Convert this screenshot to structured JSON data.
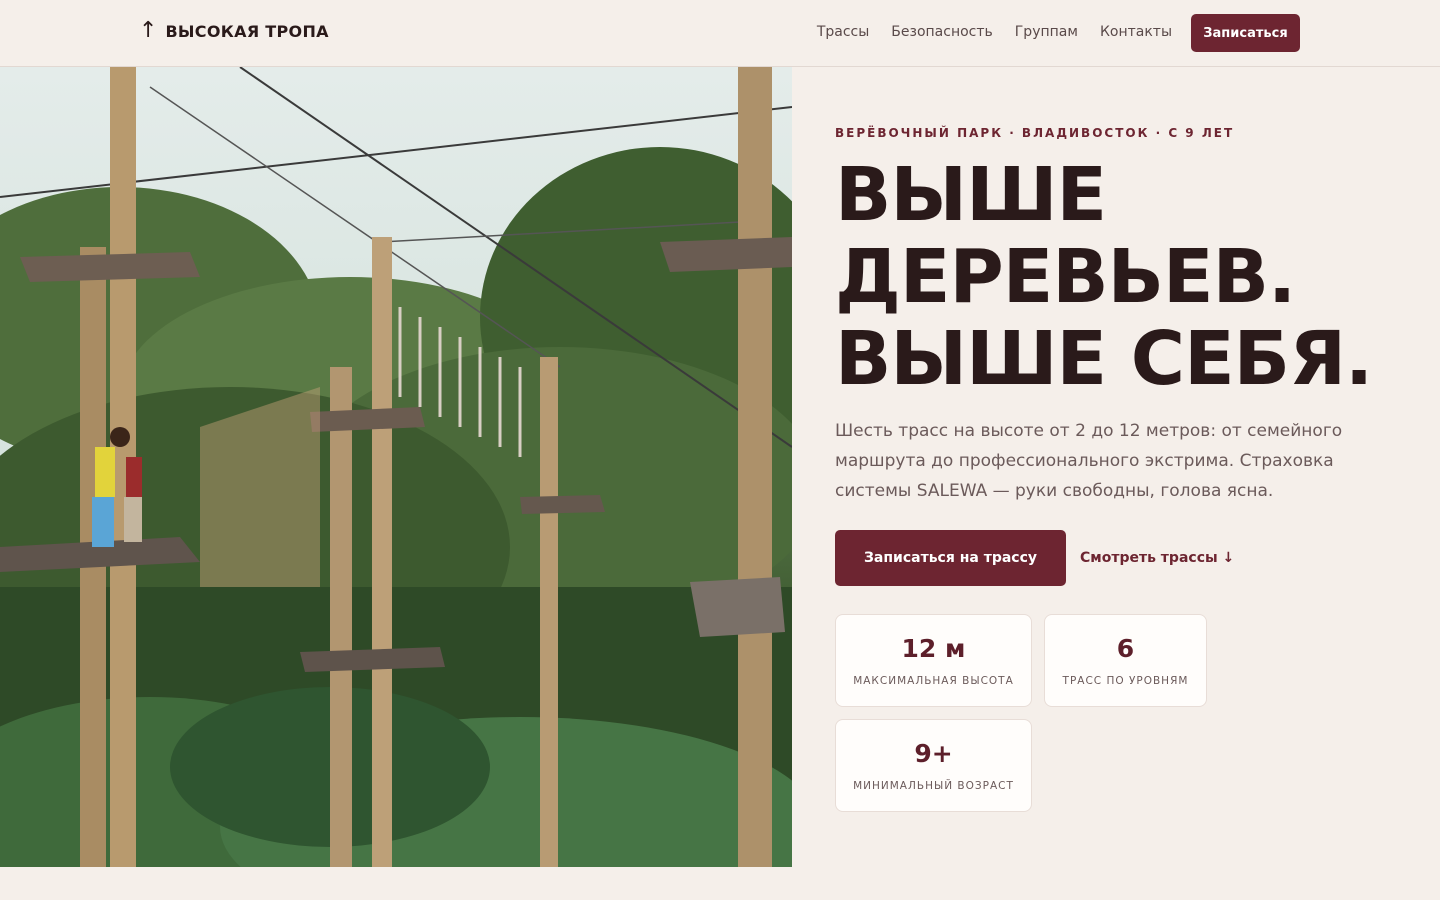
{
  "header": {
    "logo_icon": "arrow-up-icon",
    "logo_icon_glyph": "↑",
    "logo_text": "ВЫСОКАЯ ТРОПА",
    "nav": [
      {
        "label": "Трассы"
      },
      {
        "label": "Безопасность"
      },
      {
        "label": "Группам"
      },
      {
        "label": "Контакты"
      }
    ],
    "cta_label": "Записаться"
  },
  "hero": {
    "eyebrow": "ВЕРЁВОЧНЫЙ ПАРК · ВЛАДИВОСТОК · С 9 ЛЕТ",
    "headline_line1": "ВЫШЕ",
    "headline_line2": "ДЕРЕВЬЕВ.",
    "headline_line3": "ВЫШЕ СЕБЯ.",
    "lead": "Шесть трасс на высоте от 2 до 12 метров: от семейного маршрута до профессионального экстрима. Страховка системы SALEWA — руки свободны, голова ясна.",
    "primary_cta": "Записаться на трассу",
    "secondary_cta": "Смотреть трассы ↓",
    "stats": [
      {
        "value": "12 м",
        "label": "МАКСИМАЛЬНАЯ ВЫСОТА"
      },
      {
        "value": "6",
        "label": "ТРАСС ПО УРОВНЯМ"
      },
      {
        "value": "9+",
        "label": "МИНИМАЛЬНЫЙ ВОЗРАСТ"
      }
    ]
  },
  "colors": {
    "accent": "#6d2531",
    "background": "#f5efea",
    "text": "#2a1a1a"
  }
}
